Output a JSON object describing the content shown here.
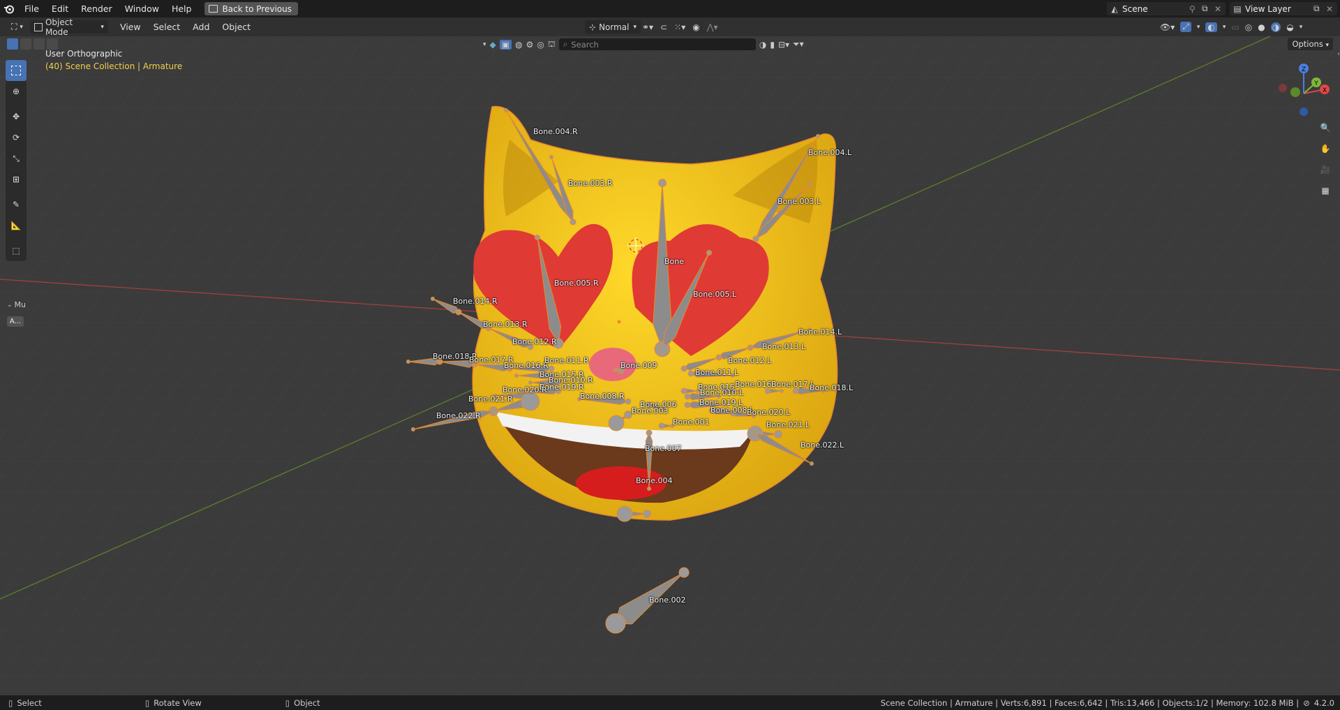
{
  "menu": {
    "file": "File",
    "edit": "Edit",
    "render": "Render",
    "window": "Window",
    "help": "Help",
    "back": "Back to Previous"
  },
  "scene": {
    "name": "Scene",
    "view_layer": "View Layer"
  },
  "header": {
    "mode": "Object Mode",
    "view": "View",
    "select": "Select",
    "add": "Add",
    "object": "Object",
    "transform_orientation": "Normal",
    "options": "Options"
  },
  "search": {
    "placeholder": "Search"
  },
  "overlay": {
    "view_name": "User Orthographic",
    "collection": "(40) Scene Collection | Armature"
  },
  "toolbar_panel": {
    "collapsed_label": "Mu",
    "button": "A..."
  },
  "bones": [
    {
      "label": "Bone.004.R"
    },
    {
      "label": "Bone.003.R"
    },
    {
      "label": "Bone.004.L"
    },
    {
      "label": "Bone.003.L"
    },
    {
      "label": "Bone"
    },
    {
      "label": "Bone.005.R"
    },
    {
      "label": "Bone.005.L"
    },
    {
      "label": "Bone.014.R"
    },
    {
      "label": "Bone.013.R"
    },
    {
      "label": "Bone.012.R"
    },
    {
      "label": "Bone.014.L"
    },
    {
      "label": "Bone.013.L"
    },
    {
      "label": "Bone.012.L"
    },
    {
      "label": "Bone.018.R"
    },
    {
      "label": "Bone.017.R"
    },
    {
      "label": "Bone.016.R"
    },
    {
      "label": "Bone.011.R"
    },
    {
      "label": "Bone.009"
    },
    {
      "label": "Bone.015.R"
    },
    {
      "label": "Bone.010.R"
    },
    {
      "label": "Bone.011.L"
    },
    {
      "label": "Bone.019.R"
    },
    {
      "label": "Bone.020.R"
    },
    {
      "label": "Bone.015"
    },
    {
      "label": "Bone.016"
    },
    {
      "label": "Bone.017.L"
    },
    {
      "label": "Bone.018.L"
    },
    {
      "label": "Bone.010.L"
    },
    {
      "label": "Bone.008.R"
    },
    {
      "label": "Bone.006"
    },
    {
      "label": "Bone.019.L"
    },
    {
      "label": "Bone.021.R"
    },
    {
      "label": "Bone.003"
    },
    {
      "label": "Bone.008.L"
    },
    {
      "label": "Bone.020.L"
    },
    {
      "label": "Bone.022.R"
    },
    {
      "label": "Bone.001"
    },
    {
      "label": "Bone.021.L"
    },
    {
      "label": "Bone.022.L"
    },
    {
      "label": "Bone.007"
    },
    {
      "label": "Bone.004"
    },
    {
      "label": "Bone.002"
    }
  ],
  "status": {
    "select": "Select",
    "rotate": "Rotate View",
    "object": "Object",
    "stats": "Scene Collection | Armature | Verts:6,891 | Faces:6,642 | Tris:13,466 | Objects:1/2 | Memory: 102.8 MiB |",
    "version": "4.2.0"
  },
  "colors": {
    "accent": "#4772b3",
    "selected_outline": "#e88a2c",
    "cat_yellow": "#f2c719",
    "heart_red": "#e03a34",
    "x_axis": "#c24747",
    "y_axis": "#6f9a2c"
  }
}
